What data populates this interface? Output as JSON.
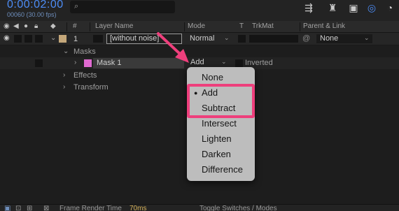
{
  "timeline": {
    "timecode": "0:00:02:00",
    "frames_fps": "00060 (30.00 fps)",
    "search": {
      "placeholder": "",
      "value": ""
    }
  },
  "columns": {
    "number": "#",
    "layer_name": "Layer Name",
    "mode": "Mode",
    "t": "T",
    "trkmat": "TrkMat",
    "parent_link": "Parent & Link"
  },
  "layer": {
    "index": "1",
    "name": "[without noise]",
    "mode": "Normal",
    "parent": "None",
    "label_color": "#c4a77a"
  },
  "masks": {
    "group_label": "Masks",
    "mask_name": "Mask 1",
    "mask_color": "#e06ad1",
    "mask_mode": "Add",
    "inverted_label": "Inverted"
  },
  "groups": {
    "effects": "Effects",
    "transform": "Transform"
  },
  "mode_menu": {
    "selected": "Add",
    "items": [
      "None",
      "Add",
      "Subtract",
      "Intersect",
      "Lighten",
      "Darken",
      "Difference"
    ]
  },
  "status": {
    "frame_render_label": "Frame Render Time",
    "frame_render_value": "70ms",
    "toggle_label": "Toggle Switches / Modes"
  },
  "annotation": {
    "color": "#ee3f7c"
  },
  "theme": {
    "timecode_color": "#4d8cf5",
    "background": "#1d1d1d"
  }
}
